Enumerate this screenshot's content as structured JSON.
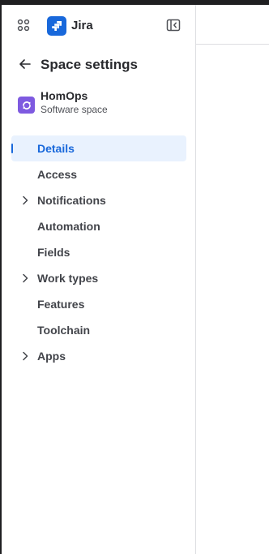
{
  "colors": {
    "brand": "#1868db",
    "active_bg": "#e9f2fe",
    "space_avatar": "#7e5ae0",
    "text": "#292a2e",
    "subtle_text": "#505258"
  },
  "header": {
    "app_name": "Jira",
    "app_switcher_icon": "grid-icon",
    "collapse_icon": "sidebar-collapse-icon"
  },
  "settings": {
    "title": "Space settings",
    "back_icon": "arrow-left-icon"
  },
  "space": {
    "name": "HomOps",
    "type": "Software space"
  },
  "nav": {
    "items": [
      {
        "label": "Details",
        "active": true,
        "expandable": false
      },
      {
        "label": "Access",
        "active": false,
        "expandable": false
      },
      {
        "label": "Notifications",
        "active": false,
        "expandable": true
      },
      {
        "label": "Automation",
        "active": false,
        "expandable": false
      },
      {
        "label": "Fields",
        "active": false,
        "expandable": false
      },
      {
        "label": "Work types",
        "active": false,
        "expandable": true
      },
      {
        "label": "Features",
        "active": false,
        "expandable": false
      },
      {
        "label": "Toolchain",
        "active": false,
        "expandable": false
      },
      {
        "label": "Apps",
        "active": false,
        "expandable": true
      }
    ]
  }
}
